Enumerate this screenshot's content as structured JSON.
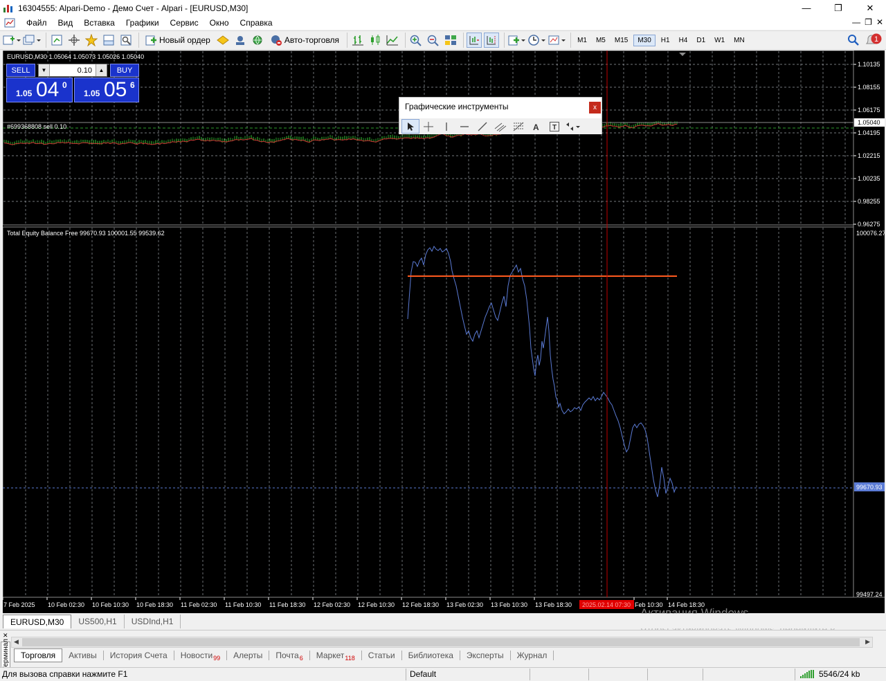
{
  "window": {
    "title": "16304555: Alpari-Demo - Демо Счет - Alpari - [EURUSD,M30]",
    "minimize": "—",
    "maximize": "❐",
    "close": "✕"
  },
  "menu": {
    "items": [
      "Файл",
      "Вид",
      "Вставка",
      "Графики",
      "Сервис",
      "Окно",
      "Справка"
    ],
    "right_minimize": "—",
    "right_restore": "❐",
    "right_close": "✕"
  },
  "toolbar": {
    "new_order": "Новый ордер",
    "auto_trading": "Авто-торговля",
    "timeframes": [
      "M1",
      "M5",
      "M15",
      "M30",
      "H1",
      "H4",
      "D1",
      "W1",
      "MN"
    ],
    "active_timeframe": "M30",
    "notifications_count": "1"
  },
  "chart": {
    "header": "EURUSD,M30  1.05064  1.05073  1.05026  1.05040",
    "order_label": "#699368808 sell 0.10",
    "price_axis": [
      "1.10135",
      "1.08155",
      "1.06175",
      "1.05040",
      "1.04195",
      "1.02215",
      "1.00235",
      "0.98255",
      "0.96275"
    ],
    "current_price": "1.05040",
    "indicator_header": "Total Equity Balance Free 99670.93 100001.55 99539.62",
    "indicator_axis_top": "100076.27",
    "indicator_axis_bottom": "99497.24",
    "indicator_current": "99670.93",
    "time_axis": [
      "7 Feb 2025",
      "10 Feb 02:30",
      "10 Feb 10:30",
      "10 Feb 18:30",
      "11 Feb 02:30",
      "11 Feb 10:30",
      "11 Feb 18:30",
      "12 Feb 02:30",
      "12 Feb 10:30",
      "12 Feb 18:30",
      "13 Feb 02:30",
      "13 Feb 10:30",
      "13 Feb 18:30",
      "Feb 10:30",
      "14 Feb 18:30"
    ],
    "crosshair_time": "2025.02.14 07:30",
    "colors": {
      "background": "#000000",
      "grid": "#9aa0a6",
      "equity_line": "#5b7bd5",
      "level_line": "#ff5a1f",
      "crosshair": "#c00000",
      "price_up": "#33cc33",
      "price_down": "#cc3333"
    }
  },
  "one_click": {
    "sell_label": "SELL",
    "buy_label": "BUY",
    "lot": "0.10",
    "sell_small": "1.05",
    "sell_big": "04",
    "sell_sup": "0",
    "buy_small": "1.05",
    "buy_big": "05",
    "buy_sup": "6"
  },
  "graphics_tools": {
    "title": "Графические инструменты",
    "close": "x"
  },
  "chart_tabs": [
    "EURUSD,M30",
    "US500,H1",
    "USDInd,H1"
  ],
  "active_chart_tab": "EURUSD,M30",
  "watermark": {
    "line1": "Активация Windows",
    "line2": "Чтобы активировать Windows, перейдите в раздел \"Параметры\"."
  },
  "terminal": {
    "side_label": "Терминал",
    "tabs": [
      {
        "label": "Торговля",
        "badge": ""
      },
      {
        "label": "Активы",
        "badge": ""
      },
      {
        "label": "История Счета",
        "badge": ""
      },
      {
        "label": "Новости",
        "badge": "99"
      },
      {
        "label": "Алерты",
        "badge": ""
      },
      {
        "label": "Почта",
        "badge": "6"
      },
      {
        "label": "Маркет",
        "badge": "118"
      },
      {
        "label": "Статьи",
        "badge": ""
      },
      {
        "label": "Библиотека",
        "badge": ""
      },
      {
        "label": "Эксперты",
        "badge": ""
      },
      {
        "label": "Журнал",
        "badge": ""
      }
    ]
  },
  "status": {
    "help": "Для вызова справки нажмите F1",
    "profile": "Default",
    "connection": "5546/24 kb"
  }
}
